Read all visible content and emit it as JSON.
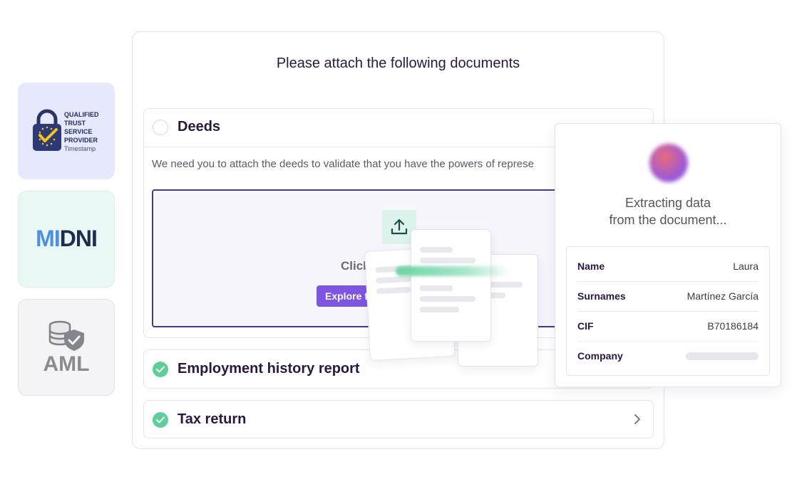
{
  "badges": {
    "qtsp": {
      "lines": [
        "QUALIFIED",
        "TRUST",
        "SERVICE",
        "PROVIDER"
      ],
      "sub": "Timestamp"
    },
    "midni": {
      "logo_mi": "MI",
      "logo_dni": "DNI"
    },
    "aml": {
      "label": "AML"
    }
  },
  "panel": {
    "title": "Please attach the following documents",
    "documents": [
      {
        "name": "Deeds",
        "status": "pending",
        "description": "We need you to attach the deeds to validate that you have the powers of represe",
        "upload": {
          "prompt": "Click",
          "button": "Explore fil"
        }
      },
      {
        "name": "Employment history report",
        "status": "done"
      },
      {
        "name": "Tax return",
        "status": "done"
      }
    ]
  },
  "extraction": {
    "message_line1": "Extracting data",
    "message_line2": "from the document...",
    "fields": [
      {
        "label": "Name",
        "value": "Laura"
      },
      {
        "label": "Surnames",
        "value": "Martínez García"
      },
      {
        "label": "CIF",
        "value": "B70186184"
      },
      {
        "label": "Company",
        "value": ""
      }
    ]
  },
  "colors": {
    "accent_purple": "#7d55e0",
    "success_green": "#5ecf9c",
    "text_dark": "#2a1840"
  }
}
